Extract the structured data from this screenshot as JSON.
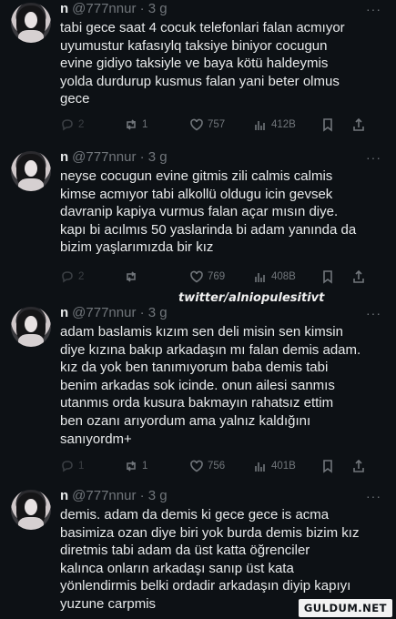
{
  "tweets": [
    {
      "name": "n",
      "handle": "@777nnur · 3 g",
      "text": "tabi gece saat 4 cocuk telefonlari falan acmıyor\nuyumustur kafasıylq taksiye biniyor cocugun\nevine gidiyo taksiyle ve baya kötü haldeymis\nyolda durdurup kusmus falan yani beter olmus\ngece",
      "replies": "2",
      "retweets": "1",
      "likes": "757",
      "views": "412B"
    },
    {
      "name": "n",
      "handle": "@777nnur · 3 g",
      "text": "neyse cocugun evine gitmis zili calmis calmis\nkimse acmıyor tabi alkollü oldugu icin gevsek\ndavranip kapiya vurmus falan açar mısın diye.\nkapı bi acılmıs 50 yaslarinda bi adam yanında da\nbizim yaşlarımızda bir kız",
      "replies": "2",
      "retweets": "",
      "likes": "769",
      "views": "408B"
    },
    {
      "name": "n",
      "handle": "@777nnur · 3 g",
      "text": "adam baslamis kızım sen deli misin sen kimsin\ndiye kızına bakıp arkadaşın mı falan demis adam.\nkız da yok ben tanımıyorum baba demis tabi\nbenim arkadas sok icinde. onun ailesi sanmıs\nutanmıs orda kusura bakmayın rahatsız ettim\nben ozanı arıyordum ama yalnız kaldığını\nsanıyordm+",
      "replies": "1",
      "retweets": "1",
      "likes": "756",
      "views": "401B"
    },
    {
      "name": "n",
      "handle": "@777nnur · 3 g",
      "text": "demis. adam da demis ki gece gece is acma\nbasimiza ozan diye biri yok burda demis bizim kız\ndiretmis tabi adam da üst katta öğrenciler\nkalınca onların arkadaşı sanıp üst kata\nyönlendirmis belki ordadir arkadaşın diyip kapıyı\nyuzune carpmis",
      "replies": "",
      "retweets": "",
      "likes": "",
      "views": ""
    }
  ],
  "watermark": "twitter/alniopulesitivt",
  "logo": "GULDUM.NET",
  "icons": [
    "more-dots-icon",
    "reply-icon",
    "retweet-icon",
    "like-icon",
    "views-icon",
    "bookmark-icon",
    "share-icon"
  ],
  "colors": {
    "background": "#0d1115",
    "text": "#e7e9ea",
    "muted": "#71767b"
  }
}
